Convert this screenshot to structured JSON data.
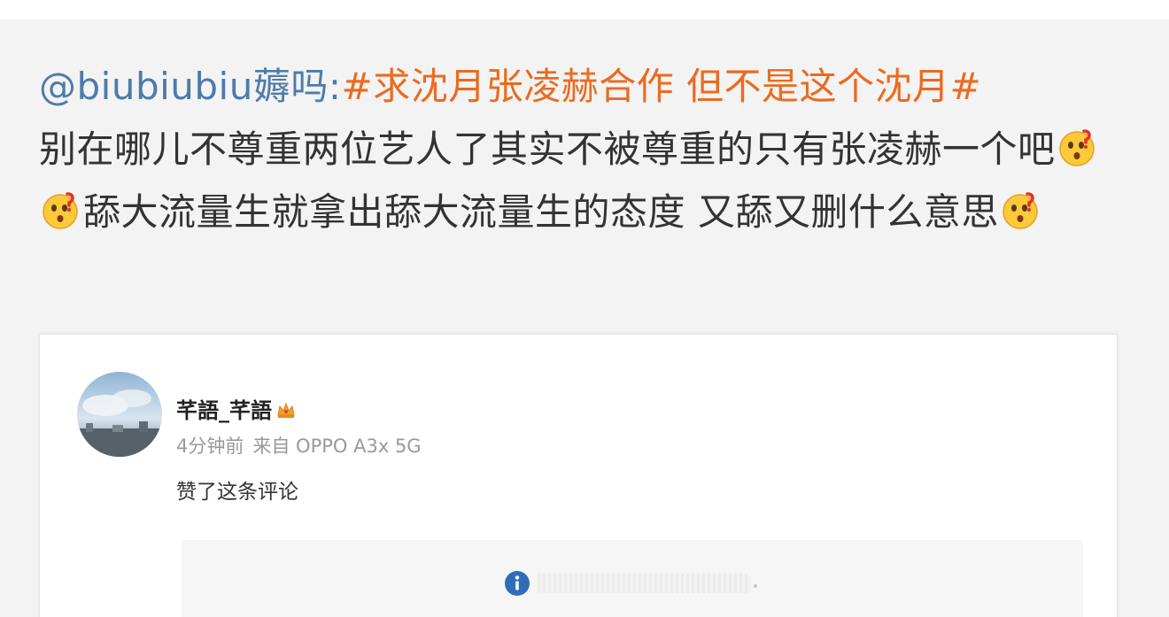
{
  "post": {
    "mention": "@biubiubiu薅吗",
    "colon": ":",
    "hashtag": "#求沈月张凌赫合作 但不是这个沈月#",
    "text_part1": "别在哪儿不尊重两位艺人了其实不被尊重的只有张凌赫一个吧",
    "text_part2": "舔大流量生就拿出舔大流量生的态度 又舔又删什么意思",
    "emoji_icon": "confused-face-emoji",
    "colors": {
      "mention": "#4d7bab",
      "hashtag": "#ea6b1f",
      "text": "#333333"
    }
  },
  "screenshot_card": {
    "username": "芊語_芊語",
    "badge_icon": "crown-icon",
    "timestamp": "4分钟前",
    "source": "来自 OPPO A3x 5G",
    "action": "赞了这条评论",
    "quoted_icon": "info-icon"
  }
}
